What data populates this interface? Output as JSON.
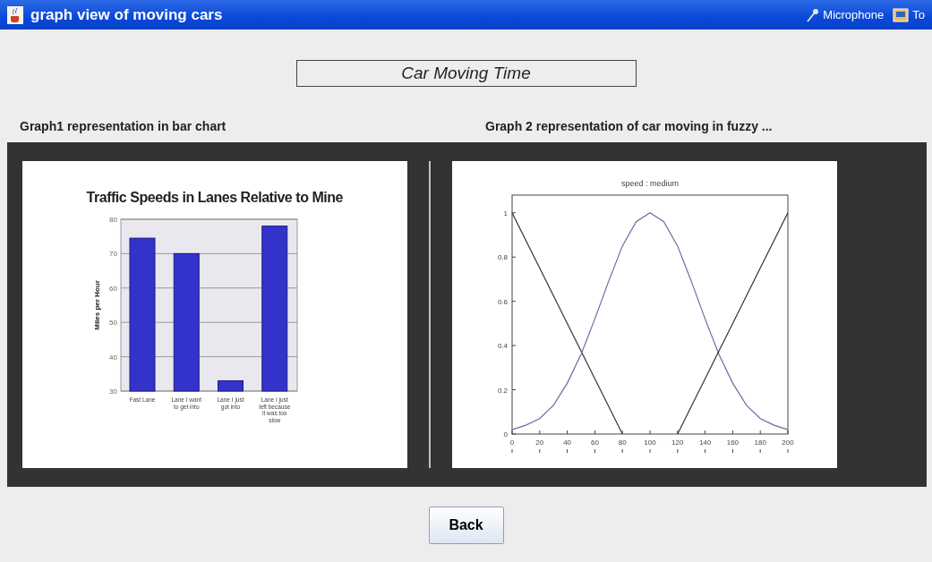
{
  "window": {
    "title": "graph view of moving cars"
  },
  "tray": [
    {
      "label": "Microphone"
    },
    {
      "label": "To"
    }
  ],
  "heading": "Car Moving Time",
  "graphs": [
    {
      "caption": "Graph1 representation in bar chart",
      "chart_data": {
        "type": "bar",
        "title": "Traffic Speeds in Lanes Relative to Mine",
        "ylabel": "Miles per Hour",
        "categories": [
          "Fast Lane",
          "Lane I want to get into",
          "Lane I just got into",
          "Lane I just left because it was too slow"
        ],
        "values": [
          74.5,
          70,
          33,
          78
        ],
        "grid": true,
        "ylim": [
          30,
          80
        ],
        "yticks": [
          30,
          40,
          50,
          60,
          70,
          80
        ]
      }
    },
    {
      "caption": "Graph 2 representation of car moving in fuzzy ...",
      "chart_data": {
        "type": "line",
        "title": "speed : medium",
        "x": [
          0,
          10,
          20,
          30,
          40,
          50,
          60,
          70,
          80,
          90,
          100,
          110,
          120,
          130,
          140,
          150,
          160,
          170,
          180,
          190,
          200
        ],
        "series": [
          {
            "color": "#333333",
            "values": [
              1,
              0.875,
              0.75,
              0.625,
              0.5,
              0.375,
              0.25,
              0.125,
              0,
              null,
              null,
              null,
              null,
              null,
              null,
              null,
              null,
              null,
              null,
              null,
              null
            ]
          },
          {
            "color": "#6a6aa8",
            "values": [
              0.02,
              0.04,
              0.07,
              0.13,
              0.23,
              0.36,
              0.52,
              0.69,
              0.85,
              0.96,
              1,
              0.96,
              0.85,
              0.69,
              0.52,
              0.36,
              0.23,
              0.13,
              0.07,
              0.04,
              0.02
            ]
          },
          {
            "color": "#333333",
            "values": [
              null,
              null,
              null,
              null,
              null,
              null,
              null,
              null,
              null,
              null,
              null,
              null,
              0,
              0.125,
              0.25,
              0.375,
              0.5,
              0.625,
              0.75,
              0.875,
              1
            ]
          }
        ],
        "xlim": [
          0,
          200
        ],
        "ylim": [
          0,
          1.08
        ],
        "xticks": [
          0,
          20,
          40,
          60,
          80,
          100,
          120,
          140,
          160,
          180,
          200
        ],
        "yticks": [
          0,
          {
            "value": 0.2,
            "label": "0.2"
          },
          {
            "value": 0.4,
            "label": "0.4"
          },
          {
            "value": 0.6,
            "label": "0.6"
          },
          {
            "value": 0.8,
            "label": "0.8"
          },
          1
        ]
      }
    }
  ],
  "buttons": [
    {
      "label": "Back"
    }
  ]
}
